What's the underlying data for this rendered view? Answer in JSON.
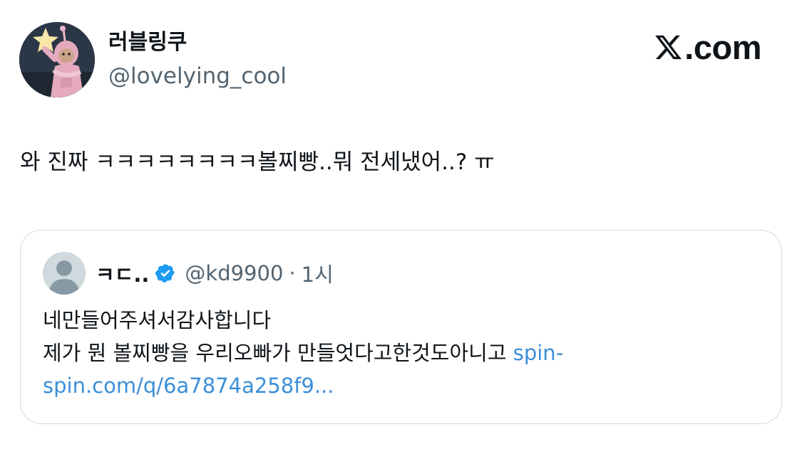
{
  "author": {
    "display_name": "러블링쿠",
    "handle": "@lovelying_cool"
  },
  "brand": {
    "text": ".com"
  },
  "tweet": {
    "text": "와 진짜 ㅋㅋㅋㅋㅋㅋㅋㅋ볼찌빵..뭐 전세냈어..? ㅠ"
  },
  "quote": {
    "name": "ㅋㄷ..",
    "handle": "@kd9900",
    "separator": "·",
    "time": "1시",
    "line1": "네만들어주셔서감사합니다",
    "line2_text": "제가 뭔 볼찌빵을 우리오빠가 만들엇다고한것도아니고 ",
    "link_part1": "spin-",
    "link_part2": "spin.com/q/6a7874a258f9..."
  },
  "colors": {
    "text_primary": "#0f1419",
    "text_secondary": "#536471",
    "link": "#3b8fd9",
    "verified": "#1d9bf0",
    "border": "#cfd9de"
  },
  "icons": {
    "brand": "x-logo-icon",
    "verified": "verified-badge-icon",
    "quote_avatar": "default-avatar-icon"
  }
}
